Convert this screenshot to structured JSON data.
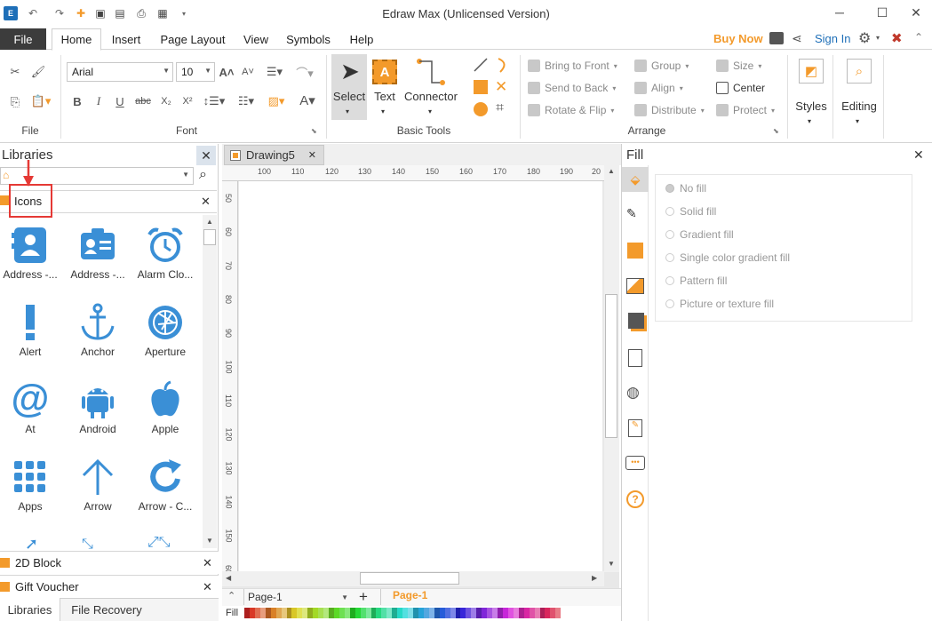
{
  "app": {
    "title": "Edraw Max (Unlicensed Version)"
  },
  "menu": {
    "file": "File",
    "tabs": [
      "Home",
      "Insert",
      "Page Layout",
      "View",
      "Symbols",
      "Help"
    ],
    "buy_now": "Buy Now",
    "sign_in": "Sign In"
  },
  "ribbon": {
    "font": {
      "family": "Arial",
      "size": "10",
      "group_label": "Font"
    },
    "file_group_label": "File",
    "basic_tools": {
      "label": "Basic Tools",
      "select": "Select",
      "text": "Text",
      "connector": "Connector"
    },
    "arrange": {
      "label": "Arrange",
      "bring_to_front": "Bring to Front",
      "send_to_back": "Send to Back",
      "rotate_flip": "Rotate & Flip",
      "group": "Group",
      "align": "Align",
      "distribute": "Distribute",
      "size": "Size",
      "center": "Center",
      "protect": "Protect"
    },
    "styles": "Styles",
    "editing": "Editing"
  },
  "libraries": {
    "title": "Libraries",
    "current": "Icons",
    "items": [
      {
        "label": "Address -...",
        "icon": "address-book-icon"
      },
      {
        "label": "Address -...",
        "icon": "address-card-icon"
      },
      {
        "label": "Alarm Clo...",
        "icon": "alarm-clock-icon"
      },
      {
        "label": "Alert",
        "icon": "alert-icon"
      },
      {
        "label": "Anchor",
        "icon": "anchor-icon"
      },
      {
        "label": "Aperture",
        "icon": "aperture-icon"
      },
      {
        "label": "At",
        "icon": "at-icon"
      },
      {
        "label": "Android",
        "icon": "android-icon"
      },
      {
        "label": "Apple",
        "icon": "apple-icon"
      },
      {
        "label": "Apps",
        "icon": "apps-icon"
      },
      {
        "label": "Arrow",
        "icon": "arrow-icon"
      },
      {
        "label": "Arrow - C...",
        "icon": "arrow-circle-icon"
      }
    ],
    "collapsed": [
      "2D Block",
      "Gift Voucher"
    ],
    "bottom_tabs": [
      "Libraries",
      "File Recovery"
    ]
  },
  "document": {
    "tab": "Drawing5",
    "ruler_h": [
      "100",
      "110",
      "120",
      "130",
      "140",
      "150",
      "160",
      "170",
      "180",
      "190",
      "20"
    ],
    "ruler_v": [
      "50",
      "60",
      "70",
      "80",
      "90",
      "100",
      "110",
      "120",
      "130",
      "140",
      "150",
      "60"
    ],
    "page_selector": "Page-1",
    "active_page": "Page-1",
    "fill_label": "Fill"
  },
  "fill_panel": {
    "title": "Fill",
    "options": [
      "No fill",
      "Solid fill",
      "Gradient fill",
      "Single color gradient fill",
      "Pattern fill",
      "Picture or texture fill"
    ]
  },
  "colors": {
    "accent_blue": "#3a8fd6",
    "orange": "#f39a2b",
    "annotation_red": "#e53935"
  }
}
